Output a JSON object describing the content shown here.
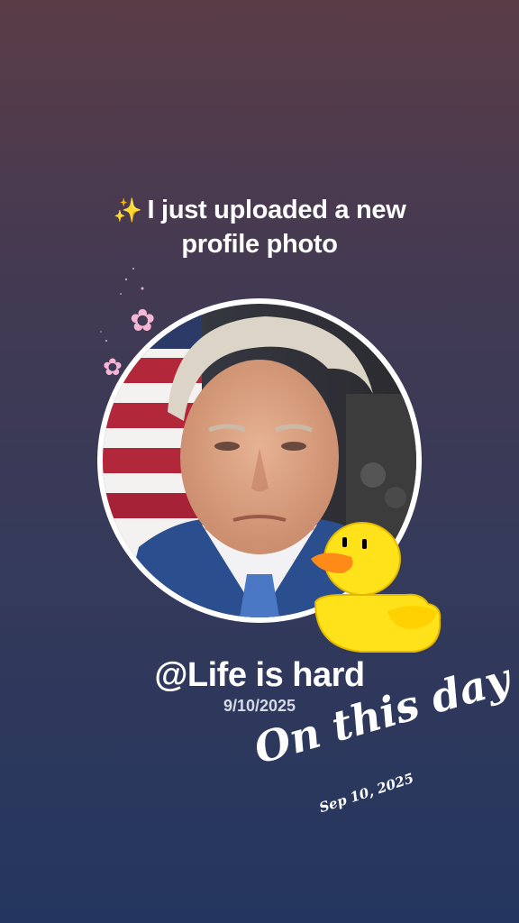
{
  "post": {
    "headline_line1": "I just uploaded a new",
    "headline_line2": "profile photo",
    "sparkle_icon": "sparkles-icon",
    "username": "@Life is hard",
    "date": "9/10/2025",
    "overlay_title": "On this day",
    "overlay_date": "Sep 10, 2025"
  },
  "colors": {
    "background_top": "#5a3c47",
    "background_bottom": "#24365f",
    "avatar_ring": "#ffffff",
    "duck": "#ffe21a",
    "flower": "#f7b7d4"
  },
  "decorations": {
    "stickers": [
      "duck-sticker",
      "cherry-blossom-icon",
      "cherry-blossom-icon"
    ]
  }
}
